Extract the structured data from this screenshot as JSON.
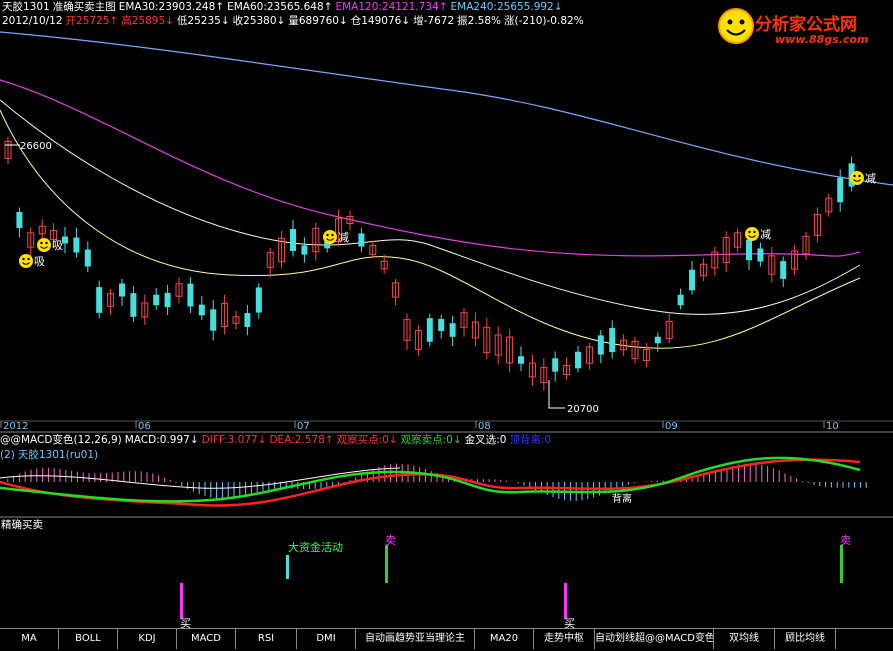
{
  "header": {
    "line1": [
      {
        "text": "天胶1301",
        "color": "#ffffff"
      },
      {
        "text": "准确买卖主图",
        "color": "#ffffff"
      },
      {
        "text": "EMA30:23903.248↑",
        "color": "#ffffff"
      },
      {
        "text": "EMA60:23565.648↑",
        "color": "#ffffff"
      },
      {
        "text": "EMA120:24121.734↑",
        "color": "#ff33ff"
      },
      {
        "text": "EMA240:25655.992↓",
        "color": "#66ccff"
      }
    ],
    "line2": [
      {
        "text": "2012/10/12",
        "color": "#ffffff"
      },
      {
        "text": "开25725↑",
        "color": "#ff3333"
      },
      {
        "text": "高25895↓",
        "color": "#ff3333"
      },
      {
        "text": "低25235↓",
        "color": "#ffffff"
      },
      {
        "text": "收25380↓",
        "color": "#ffffff"
      },
      {
        "text": "量689760↓",
        "color": "#ffffff"
      },
      {
        "text": "仓149076↓",
        "color": "#ffffff"
      },
      {
        "text": "增-7672",
        "color": "#ffffff"
      },
      {
        "text": "振2.58%",
        "color": "#ffffff"
      },
      {
        "text": "涨(-210)-0.82%",
        "color": "#ffffff"
      }
    ]
  },
  "logo": {
    "name": "分析家公式网",
    "url": "www.88gs.com"
  },
  "main_chart": {
    "price_high_label": "26600",
    "price_low_label": "20700",
    "signals": [
      {
        "text": "吸"
      },
      {
        "text": "吸"
      },
      {
        "text": "减"
      },
      {
        "text": "减"
      },
      {
        "text": "减"
      }
    ],
    "x_labels": [
      "2012",
      "06",
      "07",
      "08",
      "09",
      "10"
    ]
  },
  "macd_panel": {
    "line1": [
      {
        "text": "@@MACD变色(12,26,9)",
        "color": "#ffffff"
      },
      {
        "text": "MACD:0.997↓",
        "color": "#ffffff"
      },
      {
        "text": "DIFF:3.077↓",
        "color": "#ff3333"
      },
      {
        "text": "DEA:2.578↑",
        "color": "#ff3333"
      },
      {
        "text": "观察买点:0↓",
        "color": "#ff3333"
      },
      {
        "text": "观察卖点:0↓",
        "color": "#33cc33"
      },
      {
        "text": "金叉选:0",
        "color": "#ffffff"
      },
      {
        "text": "顶背离:0",
        "color": "#3333ff"
      }
    ],
    "line2": [
      {
        "text": "(2)",
        "color": "#66ccff"
      },
      {
        "text": "天胶1301(ru01)",
        "color": "#66ccff"
      }
    ],
    "label_divergence": "背离"
  },
  "signal_panel": {
    "title": "精确买卖",
    "labels": [
      {
        "text": "大资金活动"
      },
      {
        "text": "卖"
      },
      {
        "text": "卖"
      },
      {
        "text": "买"
      },
      {
        "text": "买"
      }
    ]
  },
  "tabs": [
    {
      "label": "MA"
    },
    {
      "label": "BOLL"
    },
    {
      "label": "KDJ"
    },
    {
      "label": "MACD"
    },
    {
      "label": "RSI"
    },
    {
      "label": "DMI"
    },
    {
      "label": "自动画趋势亚当理论主"
    },
    {
      "label": "MA20"
    },
    {
      "label": "走势中枢"
    },
    {
      "label": "自动划线超@@MACD变色"
    },
    {
      "label": "双均线"
    },
    {
      "label": "顾比均线"
    }
  ]
}
